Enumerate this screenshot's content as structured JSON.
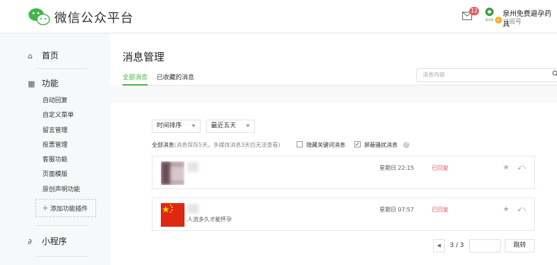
{
  "header": {
    "brand": "微信公众平台",
    "mail_badge": "12",
    "account_name": "泉州免费避孕药具",
    "account_type": "订阅号",
    "avatar_text": "泉州免",
    "colors": {
      "brand_green": "#44b549",
      "badge_red": "#e15f63"
    }
  },
  "sidebar": {
    "home": "首页",
    "features": "功能",
    "items": [
      "自动回复",
      "自定义菜单",
      "留言管理",
      "投票管理",
      "客服功能",
      "页面模版",
      "原创声明功能"
    ],
    "add_plugin": "添加功能插件",
    "miniprogram": "小程序"
  },
  "main": {
    "title": "消息管理",
    "tabs": [
      {
        "label": "全部消息",
        "active": true
      },
      {
        "label": "已收藏的消息",
        "active": false
      }
    ],
    "search_placeholder": "消息内容",
    "sort_select": "时间排序",
    "range_select": "最近五天",
    "filter_label": "全部消息",
    "filter_note": "(消息保存5天，多媒体消息3天后无法查看)",
    "hide_keyword_label": "隐藏关键词消息",
    "hide_keyword_checked": false,
    "block_spam_label": "屏蔽骚扰消息",
    "block_spam_checked": true
  },
  "messages": [
    {
      "text": "",
      "time": "星期日 22:15",
      "status": "已回复"
    },
    {
      "text": "人流多久才能怀孕",
      "time": "星期日 07:57",
      "status": "已回复"
    }
  ],
  "pager": {
    "info": "3 / 3",
    "go_label": "跳转"
  }
}
